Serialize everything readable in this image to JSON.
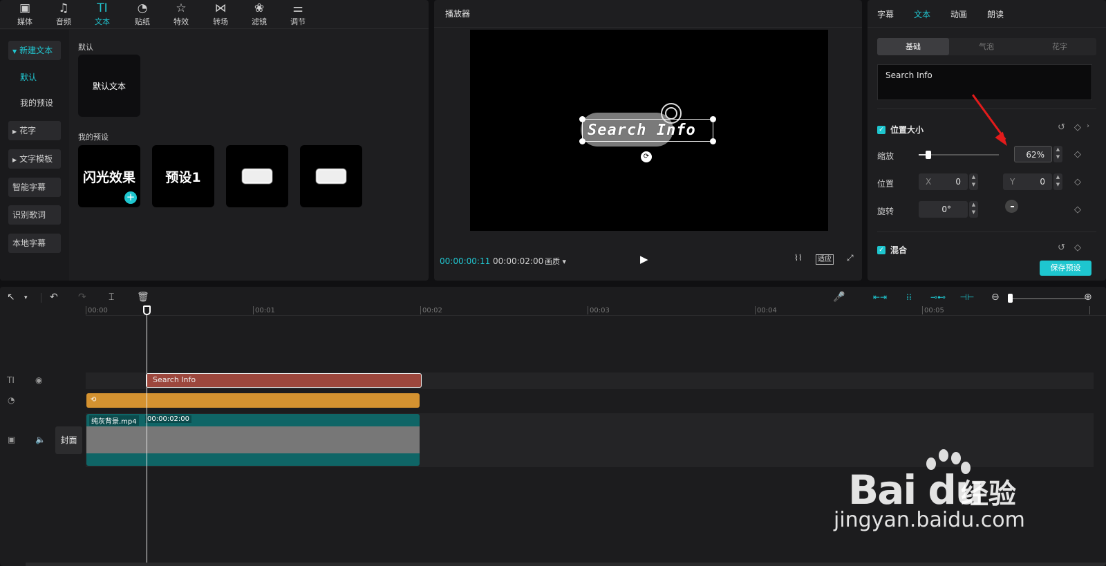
{
  "toolbar": {
    "tabs": [
      {
        "label": "媒体",
        "icon": "media-icon"
      },
      {
        "label": "音频",
        "icon": "audio-icon"
      },
      {
        "label": "文本",
        "icon": "text-icon"
      },
      {
        "label": "贴纸",
        "icon": "sticker-icon"
      },
      {
        "label": "特效",
        "icon": "effects-icon"
      },
      {
        "label": "转场",
        "icon": "transition-icon"
      },
      {
        "label": "滤镜",
        "icon": "filter-icon"
      },
      {
        "label": "调节",
        "icon": "adjust-icon"
      }
    ],
    "text_glyph": "TI"
  },
  "sidebar": {
    "items": [
      "新建文本",
      "默认",
      "我的预设",
      "花字",
      "文字模板",
      "智能字幕",
      "识别歌词",
      "本地字幕"
    ]
  },
  "library": {
    "default_section": "默认",
    "default_card": "默认文本",
    "preset_section": "我的预设",
    "presets": [
      "闪光效果",
      "预设1"
    ]
  },
  "player": {
    "title": "播放器",
    "preview_text": "Search Info",
    "current_time": "00:00:00:11",
    "total_time": "00:00:02:00",
    "quality": "画质",
    "fit_label": "适应"
  },
  "inspector": {
    "tabs": [
      "字幕",
      "文本",
      "动画",
      "朗读"
    ],
    "sub_tabs": [
      "基础",
      "气泡",
      "花字"
    ],
    "text_value": "Search Info",
    "section_position": "位置大小",
    "scale_label": "缩放",
    "scale_value": "62%",
    "scale_fraction": 0.12,
    "position_label": "位置",
    "x_axis": "X",
    "x_value": "0",
    "y_axis": "Y",
    "y_value": "0",
    "rotate_label": "旋转",
    "rotate_value": "0°",
    "section_blend": "混合",
    "save_button": "保存预设"
  },
  "timeline": {
    "ruler": [
      "00:00",
      "00:01",
      "00:02",
      "00:03",
      "00:04",
      "00:05"
    ],
    "text_clip": "Search Info",
    "video_clip_name": "纯灰背景.mp4",
    "video_clip_duration": "00:00:02:00",
    "cover_label": "封面"
  },
  "watermark": {
    "logo": "Bai  du",
    "cn": "经验",
    "url": "jingyan.baidu.com"
  },
  "colors": {
    "accent": "#1ec6cf",
    "text_clip": "#9c473d",
    "sticker_clip": "#d49230",
    "video_clip": "#0f6566",
    "annotation_arrow": "#e31b1b"
  }
}
